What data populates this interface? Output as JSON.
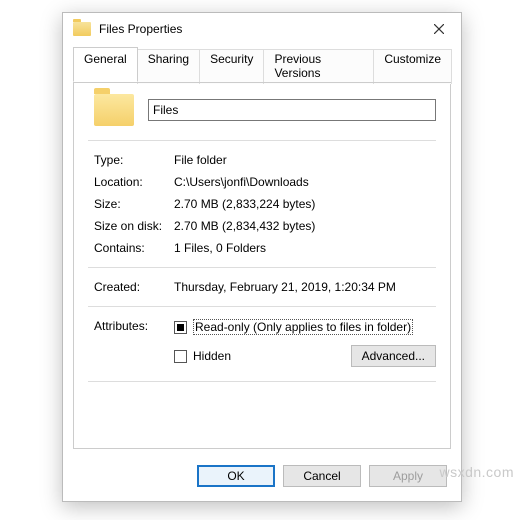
{
  "window": {
    "title": "Files Properties"
  },
  "tabs": {
    "general": "General",
    "sharing": "Sharing",
    "security": "Security",
    "previous": "Previous Versions",
    "customize": "Customize"
  },
  "name_field": {
    "value": "Files"
  },
  "rows": {
    "type": {
      "label": "Type:",
      "value": "File folder"
    },
    "location": {
      "label": "Location:",
      "value": "C:\\Users\\jonfi\\Downloads"
    },
    "size": {
      "label": "Size:",
      "value": "2.70 MB (2,833,224 bytes)"
    },
    "ondisk": {
      "label": "Size on disk:",
      "value": "2.70 MB (2,834,432 bytes)"
    },
    "contains": {
      "label": "Contains:",
      "value": "1 Files, 0 Folders"
    },
    "created": {
      "label": "Created:",
      "value": "Thursday, February 21, 2019, 1:20:34 PM"
    }
  },
  "attributes": {
    "label": "Attributes:",
    "readonly": "Read-only (Only applies to files in folder)",
    "hidden": "Hidden",
    "advanced": "Advanced..."
  },
  "footer": {
    "ok": "OK",
    "cancel": "Cancel",
    "apply": "Apply"
  },
  "watermark": "wsxdn.com"
}
